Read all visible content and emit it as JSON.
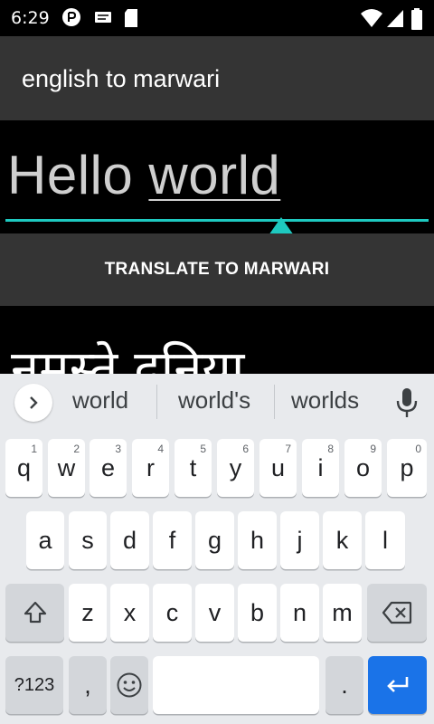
{
  "status_bar": {
    "time": "6:29"
  },
  "app_bar": {
    "title": "english to marwari"
  },
  "input": {
    "text_plain": "Hello ",
    "text_underlined": "world"
  },
  "translate_button": {
    "label": "TRANSLATE TO MARWARI"
  },
  "output": {
    "text": "नमस्ते दुनिया"
  },
  "keyboard": {
    "suggestions": [
      "world",
      "world's",
      "worlds"
    ],
    "row1": [
      {
        "k": "q",
        "n": "1"
      },
      {
        "k": "w",
        "n": "2"
      },
      {
        "k": "e",
        "n": "3"
      },
      {
        "k": "r",
        "n": "4"
      },
      {
        "k": "t",
        "n": "5"
      },
      {
        "k": "y",
        "n": "6"
      },
      {
        "k": "u",
        "n": "7"
      },
      {
        "k": "i",
        "n": "8"
      },
      {
        "k": "o",
        "n": "9"
      },
      {
        "k": "p",
        "n": "0"
      }
    ],
    "row2": [
      "a",
      "s",
      "d",
      "f",
      "g",
      "h",
      "j",
      "k",
      "l"
    ],
    "row3": [
      "z",
      "x",
      "c",
      "v",
      "b",
      "n",
      "m"
    ],
    "symbols_label": "?123",
    "comma": ",",
    "period": ".",
    "accent_color": "#1a73e8"
  },
  "icons": [
    "overflow-icon",
    "message-icon",
    "sim-icon",
    "wifi-icon",
    "signal-icon",
    "battery-icon",
    "chevron-right-icon",
    "mic-icon",
    "shift-icon",
    "backspace-icon",
    "emoji-icon",
    "enter-icon"
  ]
}
